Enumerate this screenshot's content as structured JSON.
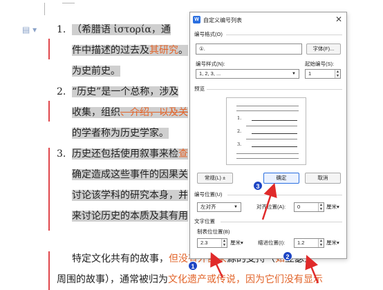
{
  "document": {
    "items": [
      {
        "num": "1.",
        "lines": [
          [
            {
              "t": "（希腊语 ",
              "c": ""
            },
            {
              "t": "ἱστορία",
              "c": ""
            },
            {
              "t": "，通",
              "c": ""
            }
          ],
          [
            {
              "t": "件中描述的过去及",
              "c": ""
            },
            {
              "t": "其研究",
              "c": "ins"
            },
            {
              "t": "。",
              "c": ""
            }
          ],
          [
            {
              "t": "为史前史。",
              "c": ""
            }
          ]
        ]
      },
      {
        "num": "2.",
        "lines": [
          [
            {
              "t": "“历史”是一个总称，涉及",
              "c": ""
            }
          ],
          [
            {
              "t": "收集，组织",
              "c": ""
            },
            {
              "t": "、介绍，以及关",
              "c": "del"
            }
          ],
          [
            {
              "t": "的学者称为历史学家。",
              "c": ""
            }
          ]
        ]
      },
      {
        "num": "3.",
        "lines": [
          [
            {
              "t": "历史还包括使用叙事来检",
              "c": ""
            },
            {
              "t": "查",
              "c": "ins"
            }
          ],
          [
            {
              "t": "确定造成这些事件的因果关",
              "c": ""
            }
          ],
          [
            {
              "t": "讨论该学科的研究本身，并",
              "c": ""
            }
          ],
          [
            {
              "t": "来讨论历史的本质及其有用",
              "c": ""
            }
          ]
        ]
      }
    ],
    "para_line1": [
      {
        "t": "特定文化共有的故事，",
        "c": ""
      },
      {
        "t": "但没有外部来",
        "c": "ins"
      },
      {
        "t": "源的支持（",
        "c": ""
      },
      {
        "t": "如",
        "c": "ins"
      },
      {
        "t": "亚瑟王",
        "c": ""
      }
    ],
    "para_line2": [
      {
        "t": "周围的故事），通常被归为",
        "c": ""
      },
      {
        "t": "文化遗产或传说，因为它们没有显示",
        "c": "ins"
      }
    ]
  },
  "dialog": {
    "title": "自定义编号列表",
    "close_glyph": "✕",
    "app_icon_letter": "W",
    "number_format_section": "编号格式(O)",
    "number_format_value": "①.",
    "font_button": "字体(F)...",
    "number_style_label": "编号样式(N):",
    "number_style_value": "1, 2, 3, ...",
    "start_at_label": "起始编号(S):",
    "start_at_value": "1",
    "preview_section": "预览",
    "preview_numbers": [
      "1.",
      "2.",
      "3."
    ],
    "normal_button": "常规(L) ±",
    "ok_button": "确定",
    "cancel_button": "取消",
    "number_position_section": "编号位置(U)",
    "alignment_value": "左对齐",
    "aligned_at_label": "对齐位置(A):",
    "aligned_at_value": "0",
    "aligned_at_unit": "厘米",
    "text_position_section": "文字位置",
    "tab_position_label": "制表位位置(B)",
    "tab_position_value": "2.3",
    "tab_position_unit": "厘米",
    "indent_label": "缩进位置(I):",
    "indent_value": "1.2",
    "indent_unit": "厘米"
  },
  "annotations": {
    "badges": [
      "1",
      "2",
      "3"
    ],
    "arrow_color": "#e02a2a",
    "badge_color": "#1d45c4"
  }
}
